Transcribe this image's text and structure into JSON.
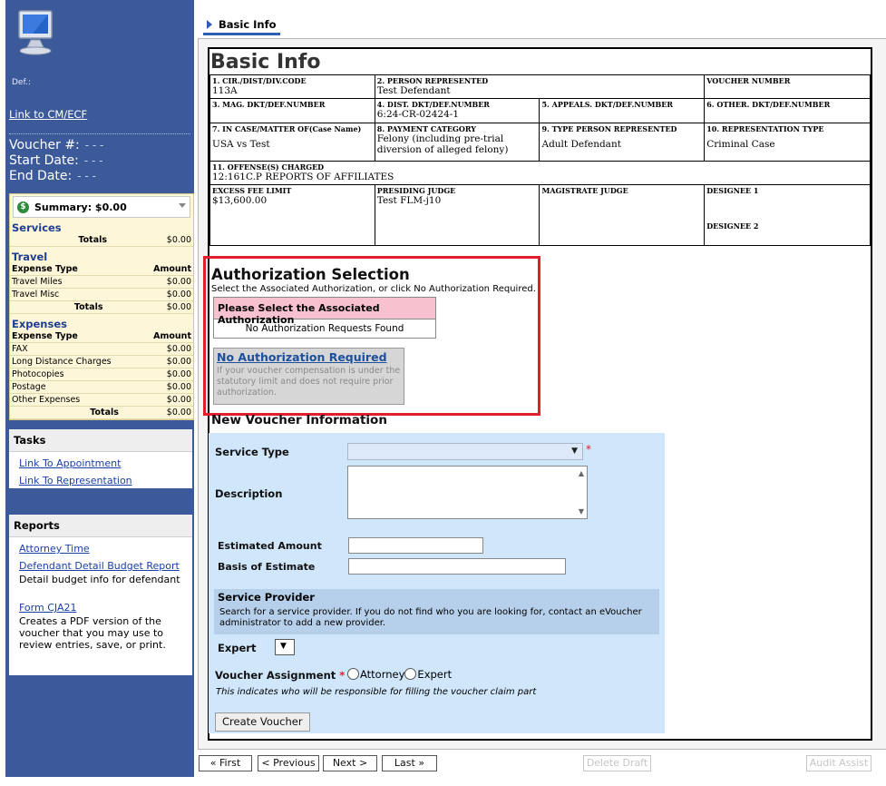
{
  "sidebar": {
    "def_label": "Def.:",
    "link_cmecf": "Link to CM/ECF",
    "voucher_label": "Voucher #:",
    "voucher_value": "- - -",
    "start_label": "Start Date:",
    "start_value": "- - -",
    "end_label": "End Date:",
    "end_value": "- - -"
  },
  "summary": {
    "title": "Summary: $0.00",
    "services": {
      "title": "Services",
      "totals_label": "Totals",
      "totals_value": "$0.00"
    },
    "travel": {
      "title": "Travel",
      "col_type": "Expense Type",
      "col_amount": "Amount",
      "rows": [
        {
          "type": "Travel Miles",
          "amount": "$0.00"
        },
        {
          "type": "Travel Misc",
          "amount": "$0.00"
        }
      ],
      "totals_label": "Totals",
      "totals_value": "$0.00"
    },
    "expenses": {
      "title": "Expenses",
      "col_type": "Expense Type",
      "col_amount": "Amount",
      "rows": [
        {
          "type": "FAX",
          "amount": "$0.00"
        },
        {
          "type": "Long Distance Charges",
          "amount": "$0.00"
        },
        {
          "type": "Photocopies",
          "amount": "$0.00"
        },
        {
          "type": "Postage",
          "amount": "$0.00"
        },
        {
          "type": "Other Expenses",
          "amount": "$0.00"
        }
      ],
      "totals_label": "Totals",
      "totals_value": "$0.00"
    }
  },
  "tasks": {
    "title": "Tasks",
    "links": [
      "Link To Appointment",
      "Link To Representation"
    ]
  },
  "reports": {
    "title": "Reports",
    "attorney_time": "Attorney Time",
    "defendant_budget": "Defendant Detail Budget Report",
    "defendant_budget_desc": "Detail budget info for defendant",
    "form_cja21": "Form CJA21",
    "form_cja21_desc": "Creates a PDF version of the voucher that you may use to review entries, save, or print."
  },
  "tab": {
    "label": "Basic Info"
  },
  "page_title": "Basic Info",
  "info": {
    "cir_label": "1. CIR./DIST/DIV.CODE",
    "cir_value": "113A",
    "person_label": "2. PERSON REPRESENTED",
    "person_value": "Test Defendant",
    "voucher_label": "VOUCHER NUMBER",
    "voucher_value": "",
    "mag_label": "3. MAG. DKT/DEF.NUMBER",
    "mag_value": "",
    "dist_label": "4. DIST. DKT/DEF.NUMBER",
    "dist_value": "6:24-CR-02424-1",
    "appeals_label": "5. APPEALS. DKT/DEF.NUMBER",
    "appeals_value": "",
    "other_label": "6. OTHER. DKT/DEF.NUMBER",
    "other_value": "",
    "case_label": "7. IN CASE/MATTER OF(Case Name)",
    "case_value": "USA vs Test",
    "payment_label": "8. PAYMENT CATEGORY",
    "payment_value": "Felony (including pre-trial diversion of alleged felony)",
    "type_person_label": "9. TYPE PERSON REPRESENTED",
    "type_person_value": "Adult Defendant",
    "rep_type_label": "10. REPRESENTATION TYPE",
    "rep_type_value": "Criminal Case",
    "offense_label": "11. OFFENSE(S) CHARGED",
    "offense_value": "12:161C.P REPORTS OF AFFILIATES",
    "excess_label": "EXCESS FEE LIMIT",
    "excess_value": "$13,600.00",
    "judge_label": "PRESIDING JUDGE",
    "judge_value": "Test FLM-j10",
    "magistrate_label": "MAGISTRATE JUDGE",
    "magistrate_value": "",
    "designee1_label": "DESIGNEE 1",
    "designee2_label": "DESIGNEE 2"
  },
  "auth": {
    "title": "Authorization Selection",
    "subtitle": "Select the Associated Authorization, or click No Authorization Required.",
    "table_header": "Please Select the Associated Authorization",
    "table_empty": "No Authorization Requests Found",
    "no_auth_link": "No Authorization Required",
    "no_auth_desc": "If your voucher compensation is under the statutory limit and does not require prior authorization."
  },
  "new_voucher": {
    "title": "New Voucher Information",
    "service_type_label": "Service Type",
    "service_type_value": "",
    "description_label": "Description",
    "estimated_label": "Estimated Amount",
    "basis_label": "Basis of Estimate",
    "provider_title": "Service Provider",
    "provider_desc": "Search for a service provider. If you do not find who you are looking for, contact an eVoucher administrator to add a new provider.",
    "expert_label": "Expert",
    "assignment_label": "Voucher Assignment",
    "opt_attorney": "Attorney",
    "opt_expert": "Expert",
    "assignment_note": "This indicates who will be responsible for filling the voucher claim part",
    "create_button": "Create Voucher"
  },
  "nav": {
    "first": "« First",
    "previous": "< Previous",
    "next": "Next >",
    "last": "Last »",
    "delete_draft": "Delete Draft",
    "audit_assist": "Audit Assist"
  },
  "colors": {
    "sidebar": "#3c5a9a",
    "highlight": "#e31d2b",
    "form_bg": "#cfe6fb",
    "auth_header": "#f8c1cf"
  }
}
